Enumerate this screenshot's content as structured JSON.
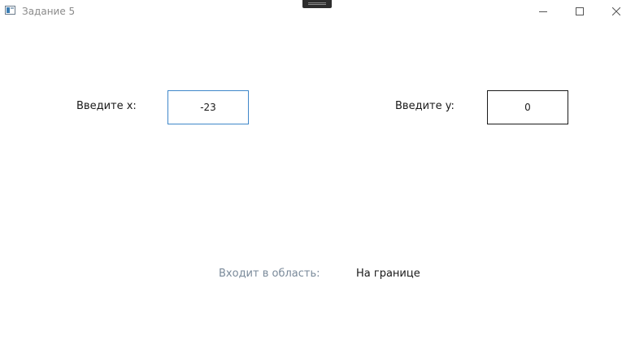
{
  "window": {
    "title": "Задание 5"
  },
  "form": {
    "x_label": "Введите x:",
    "x_value": "-23",
    "y_label": "Введите y:",
    "y_value": "0"
  },
  "result": {
    "caption": "Входит в область:",
    "value": "На границе"
  }
}
